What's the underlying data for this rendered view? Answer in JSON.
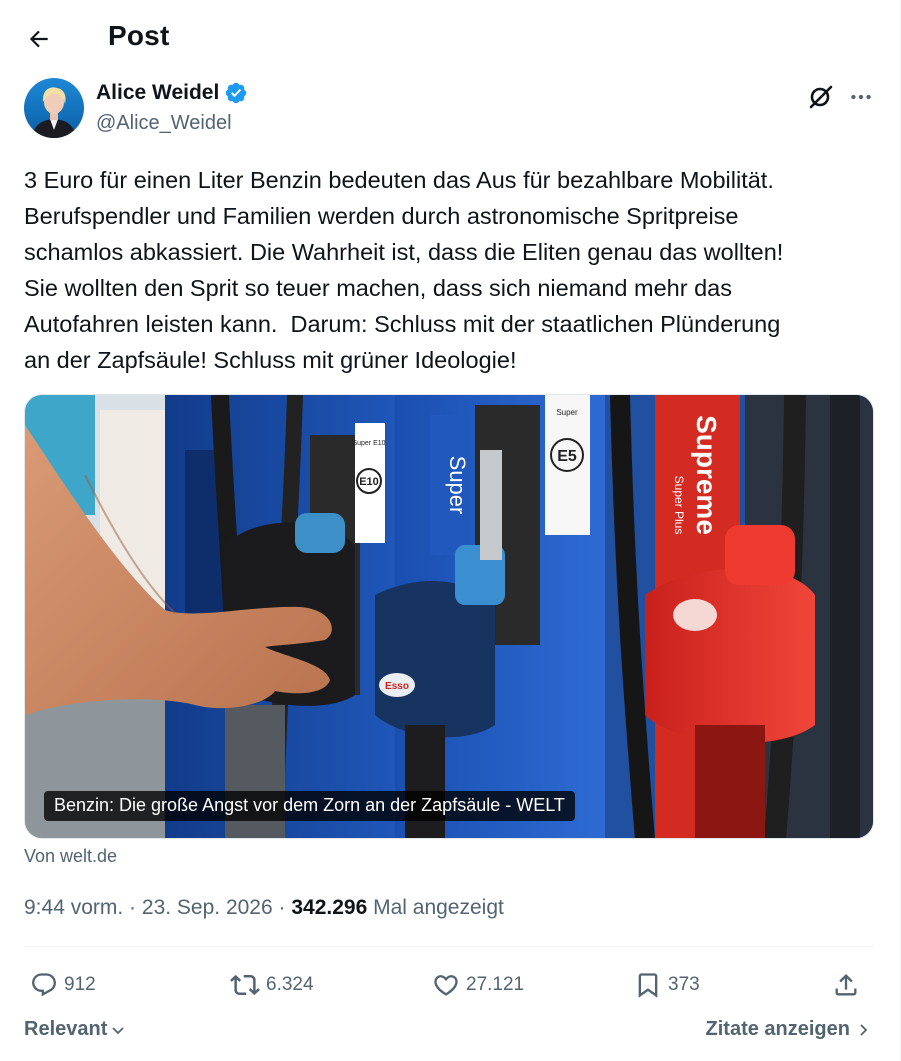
{
  "header": {
    "title": "Post",
    "back_icon": "arrow-left-icon"
  },
  "author": {
    "display_name": "Alice Weidel",
    "handle": "@Alice_Weidel",
    "verified": true,
    "verified_color": "#1d9bf0"
  },
  "tweet": {
    "text": "3 Euro für einen Liter Benzin bedeuten das Aus für bezahlbare Mobilität.\nBerufspendler und Familien werden durch astronomische Spritpreise\nschamlos abkassiert. Die Wahrheit ist, dass die Eliten genau das wollten!\nSie wollten den Sprit so teuer machen, dass sich niemand mehr das\nAutofahren leisten kann.  Darum: Schluss mit der staatlichen Plünderung\nan der Zapfsäule! Schluss mit grüner Ideologie!"
  },
  "card": {
    "caption": "Benzin: Die große Angst vor dem Zorn an der Zapfsäule - WELT",
    "source": "Von welt.de",
    "image_labels": {
      "pump_left": "E10",
      "pump_left_small": "Super E10",
      "pump_middle": "Super",
      "pump_right": "E5",
      "pump_right_small": "Super",
      "brand": "Supreme",
      "brand_sub": "Super Plus",
      "nozzle_logo": "Esso"
    }
  },
  "meta": {
    "time": "9:44 vorm.",
    "separator": " · ",
    "date": "23. Sep. 2026",
    "separator2": " · ",
    "views": "342.296",
    "views_label": " Mal angezeigt"
  },
  "actions": {
    "replies": "912",
    "reposts": "6.324",
    "likes": "27.121",
    "bookmarks": "373"
  },
  "footer": {
    "sort_label": "Relevant",
    "quotes_label": "Zitate anzeigen"
  },
  "colors": {
    "text": "#0f1419",
    "secondary": "#536471",
    "accent": "#1d9bf0"
  }
}
